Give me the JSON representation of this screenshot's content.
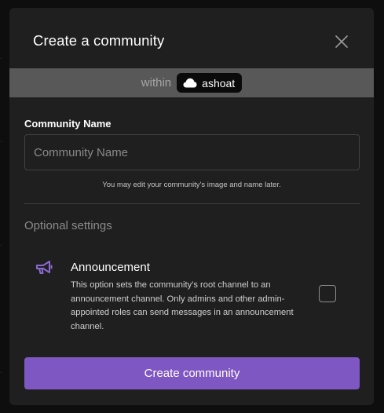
{
  "modal": {
    "title": "Create a community",
    "close_icon": "close-icon"
  },
  "within": {
    "label": "within",
    "community_icon": "cloud-icon",
    "community_name": "ashoat"
  },
  "form": {
    "name_label": "Community Name",
    "name_placeholder": "Community Name",
    "name_value": "",
    "helper_text": "You may edit your community's image and name later."
  },
  "optional": {
    "section_label": "Optional settings",
    "announcement": {
      "icon": "megaphone-icon",
      "title": "Announcement",
      "description": "This option sets the community's root channel to an announcement channel. Only admins and other admin-appointed roles can send messages in an announcement channel.",
      "checked": false
    }
  },
  "actions": {
    "submit_label": "Create community"
  },
  "colors": {
    "accent": "#7e57c2",
    "modal_bg": "#1f1f1f",
    "within_bar_bg": "#585858",
    "megaphone": "#8c6ad3"
  }
}
